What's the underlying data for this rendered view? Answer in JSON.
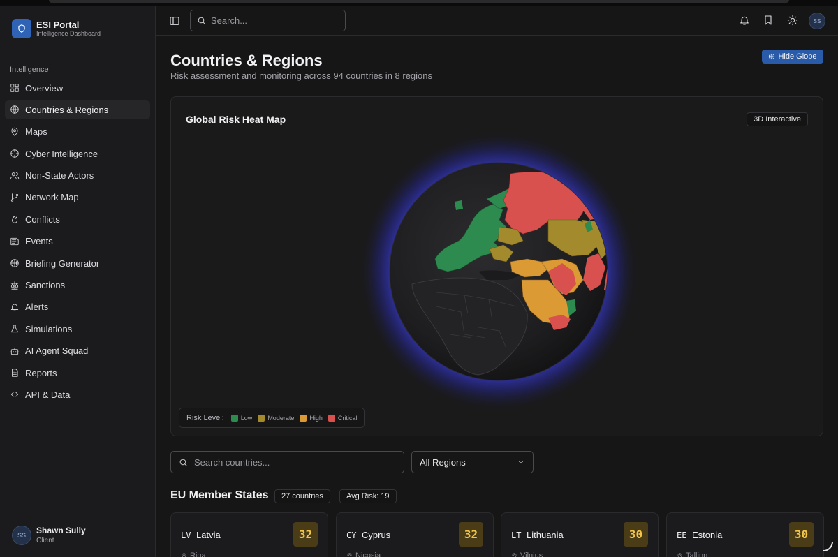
{
  "brand": {
    "title": "ESI Portal",
    "subtitle": "Intelligence Dashboard"
  },
  "sidebar": {
    "section_label": "Intelligence",
    "items": [
      {
        "label": "Overview",
        "icon": "grid-icon",
        "active": false
      },
      {
        "label": "Countries & Regions",
        "icon": "globe-icon",
        "active": true
      },
      {
        "label": "Maps",
        "icon": "map-pin-icon",
        "active": false
      },
      {
        "label": "Cyber Intelligence",
        "icon": "crosshair-icon",
        "active": false
      },
      {
        "label": "Non-State Actors",
        "icon": "users-icon",
        "active": false
      },
      {
        "label": "Network Map",
        "icon": "git-branch-icon",
        "active": false
      },
      {
        "label": "Conflicts",
        "icon": "flame-icon",
        "active": false
      },
      {
        "label": "Events",
        "icon": "newspaper-icon",
        "active": false
      },
      {
        "label": "Briefing Generator",
        "icon": "basketball-icon",
        "active": false
      },
      {
        "label": "Sanctions",
        "icon": "scale-icon",
        "active": false
      },
      {
        "label": "Alerts",
        "icon": "bell-icon",
        "active": false
      },
      {
        "label": "Simulations",
        "icon": "flask-icon",
        "active": false
      },
      {
        "label": "AI Agent Squad",
        "icon": "bot-icon",
        "active": false
      },
      {
        "label": "Reports",
        "icon": "file-text-icon",
        "active": false
      },
      {
        "label": "API & Data",
        "icon": "code-icon",
        "active": false
      }
    ]
  },
  "user": {
    "initials": "SS",
    "name": "Shawn Sully",
    "role": "Client"
  },
  "topbar": {
    "search_placeholder": "Search...",
    "avatar_initials": "SS"
  },
  "page": {
    "title": "Countries & Regions",
    "subtitle": "Risk assessment and monitoring across 94 countries in 8 regions",
    "hide_globe_label": "Hide Globe"
  },
  "map": {
    "title": "Global Risk Heat Map",
    "badge": "3D Interactive",
    "legend_label": "Risk Level:",
    "legend": [
      {
        "label": "Low",
        "color": "#2e8b4f"
      },
      {
        "label": "Moderate",
        "color": "#a38a2c"
      },
      {
        "label": "High",
        "color": "#dc9a35"
      },
      {
        "label": "Critical",
        "color": "#d9514f"
      }
    ]
  },
  "filters": {
    "search_placeholder": "Search countries...",
    "region_value": "All Regions"
  },
  "group": {
    "title": "EU Member States",
    "count_label": "27 countries",
    "avg_label": "Avg Risk: 19"
  },
  "countries": [
    {
      "code": "LV",
      "name": "Latvia",
      "score": "32",
      "capital": "Riga"
    },
    {
      "code": "CY",
      "name": "Cyprus",
      "score": "32",
      "capital": "Nicosia"
    },
    {
      "code": "LT",
      "name": "Lithuania",
      "score": "30",
      "capital": "Vilnius"
    },
    {
      "code": "EE",
      "name": "Estonia",
      "score": "30",
      "capital": "Tallinn"
    }
  ]
}
